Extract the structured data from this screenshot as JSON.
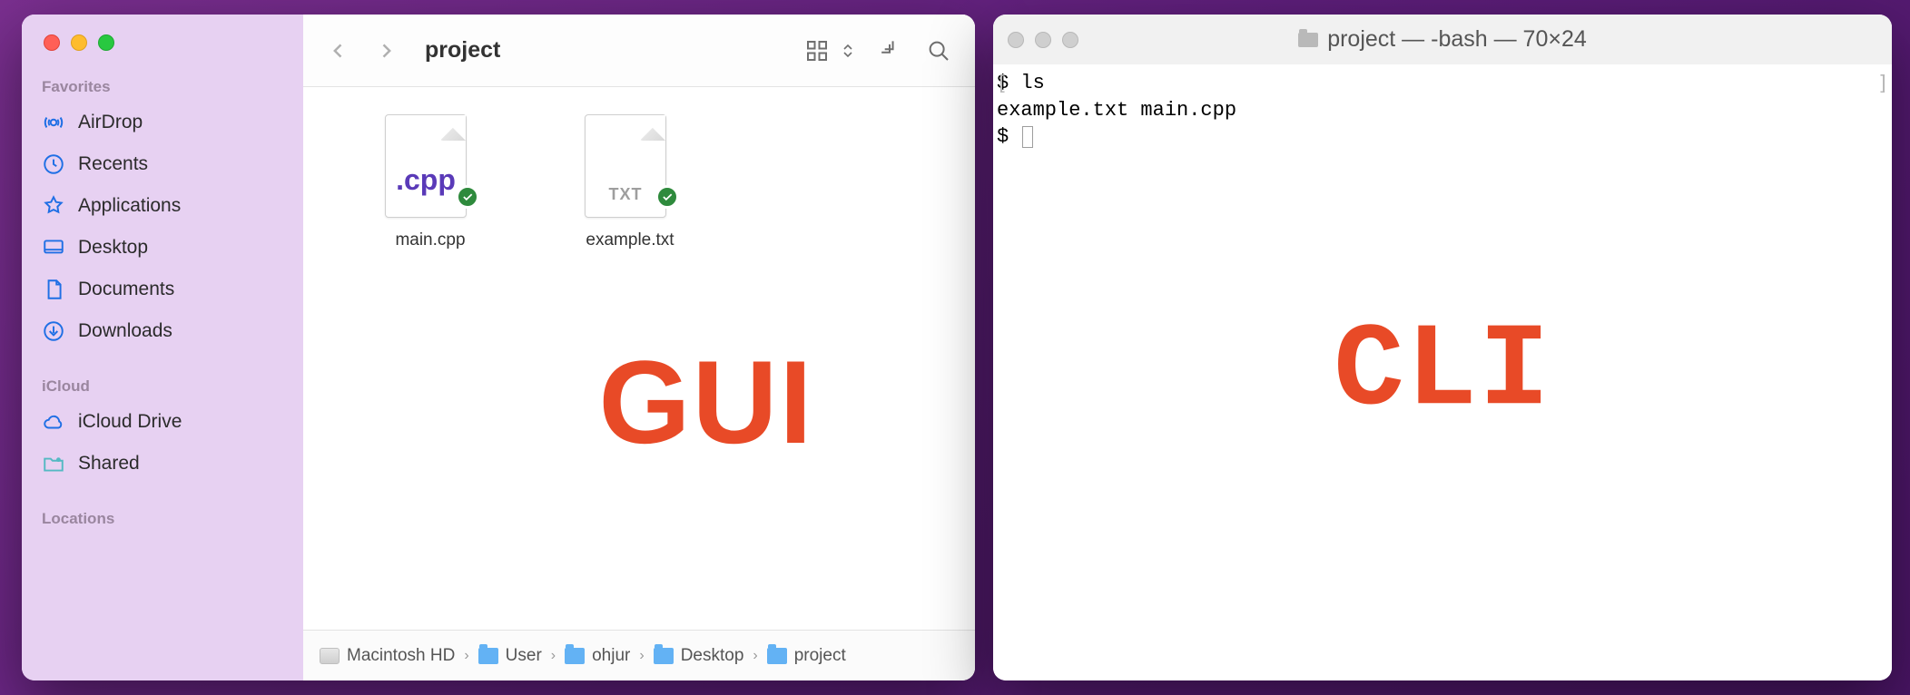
{
  "finder": {
    "title": "project",
    "sidebar": {
      "sections": {
        "favorites": "Favorites",
        "icloud": "iCloud",
        "locations": "Locations"
      },
      "favorites": [
        {
          "label": "AirDrop"
        },
        {
          "label": "Recents"
        },
        {
          "label": "Applications"
        },
        {
          "label": "Desktop"
        },
        {
          "label": "Documents"
        },
        {
          "label": "Downloads"
        }
      ],
      "icloud": [
        {
          "label": "iCloud Drive"
        },
        {
          "label": "Shared"
        }
      ]
    },
    "files": [
      {
        "name": "main.cpp",
        "ext_label": ".cpp",
        "kind": "cpp"
      },
      {
        "name": "example.txt",
        "ext_label": "TXT",
        "kind": "txt"
      }
    ],
    "path": [
      {
        "label": "Macintosh HD",
        "icon": "disk"
      },
      {
        "label": "User",
        "icon": "folder"
      },
      {
        "label": "ohjur",
        "icon": "folder"
      },
      {
        "label": "Desktop",
        "icon": "folder"
      },
      {
        "label": "project",
        "icon": "folder"
      }
    ],
    "overlay": "GUI"
  },
  "terminal": {
    "title": "project — -bash — 70×24",
    "lines": [
      "$ ls",
      "example.txt main.cpp",
      "$ "
    ],
    "overlay": "CLI"
  }
}
